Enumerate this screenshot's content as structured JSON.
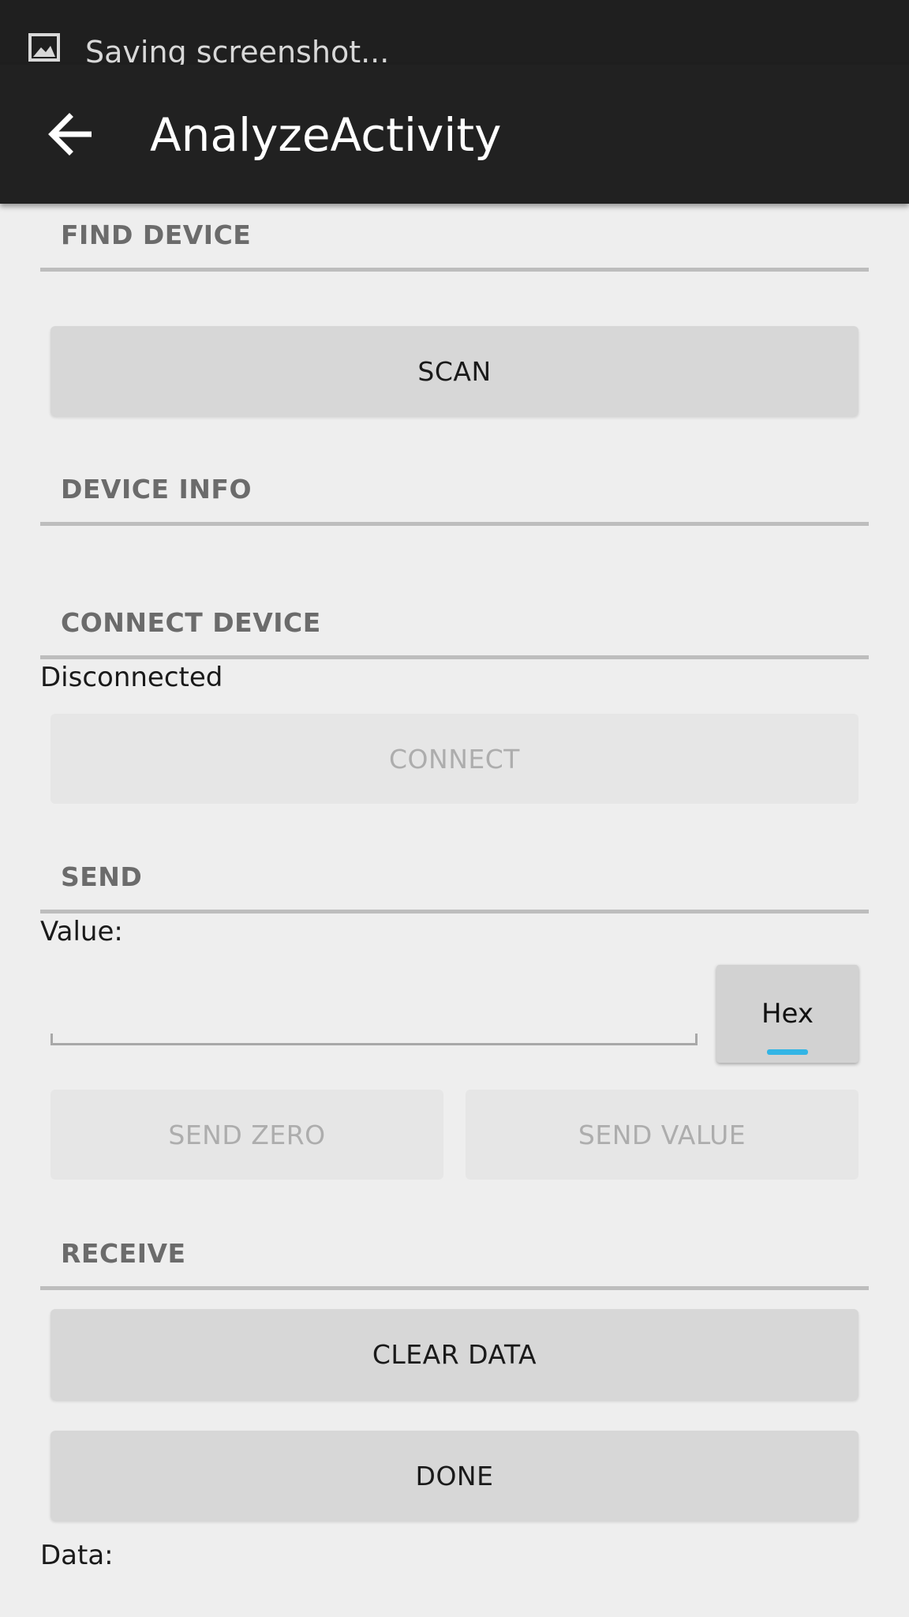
{
  "status_bar": {
    "notification_text": "Saving screenshot..."
  },
  "app_bar": {
    "title": "AnalyzeActivity",
    "back_icon": "arrow-left-icon"
  },
  "sections": {
    "find_device": {
      "header": "FIND DEVICE",
      "scan_button": "SCAN"
    },
    "device_info": {
      "header": "DEVICE INFO"
    },
    "connect_device": {
      "header": "CONNECT DEVICE",
      "status": "Disconnected",
      "connect_button": "CONNECT"
    },
    "send": {
      "header": "SEND",
      "value_label": "Value:",
      "value_input": "",
      "hex_toggle": "Hex",
      "send_zero_button": "SEND ZERO",
      "send_value_button": "SEND VALUE"
    },
    "receive": {
      "header": "RECEIVE",
      "clear_button": "CLEAR DATA",
      "done_button": "DONE",
      "data_label": "Data:"
    }
  },
  "colors": {
    "app_bar": "#212121",
    "background": "#eeeeee",
    "toggle_indicator": "#33b5e5"
  }
}
